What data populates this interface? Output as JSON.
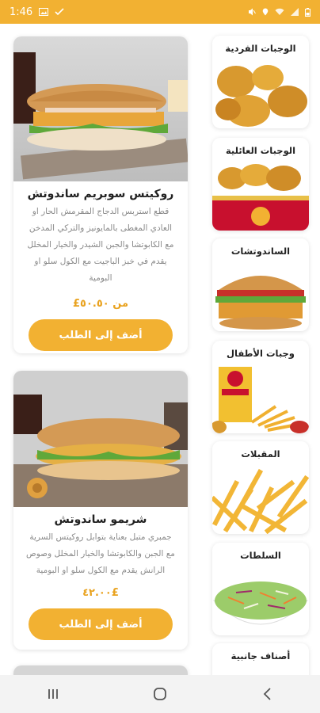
{
  "status_bar": {
    "time": "1:46",
    "left_icons": [
      "image-icon",
      "check-icon"
    ],
    "right_icons": [
      "mute-icon",
      "location-icon",
      "wifi-icon",
      "signal-icon",
      "battery-icon"
    ]
  },
  "products": [
    {
      "title": "روكيتس سوبريم ساندوتش",
      "description": "قطع استربس الدجاج المقرمش الحار او العادي المغطى بالمايونيز والتركي المدخن مع الكابوتشا والجبن الشيدر والخيار المخلل يقدم في خبز الباجيت مع الكول سلو او البومية",
      "price": "من ٥٠.٥٠£",
      "add_label": "أضف إلى الطلب"
    },
    {
      "title": "شريمو ساندوتش",
      "description": "جمبري متبل بعناية بتوابل روكيتس السرية مع الجبن والكابوتشا والخيار المخلل وصوص الرانش يقدم مع الكول سلو او البومية",
      "price": "£٤٢.٠٠",
      "add_label": "أضف إلى الطلب"
    }
  ],
  "categories": [
    {
      "label": "الوجبات الفردية",
      "icon": "fried-chicken-image"
    },
    {
      "label": "الوجبات العائلية",
      "icon": "chicken-bucket-image"
    },
    {
      "label": "الساندوتشات",
      "icon": "burger-image"
    },
    {
      "label": "وجبات الأطفال",
      "icon": "kids-meal-image"
    },
    {
      "label": "المقبلات",
      "icon": "fries-image"
    },
    {
      "label": "السلطات",
      "icon": "salad-image"
    },
    {
      "label": "أصناف جانبية",
      "icon": "side-items-image"
    }
  ],
  "nav_bar": {
    "icons": [
      "recent-apps-icon",
      "home-icon",
      "back-icon"
    ]
  },
  "colors": {
    "accent": "#f2b132",
    "price": "#e9a21e"
  }
}
